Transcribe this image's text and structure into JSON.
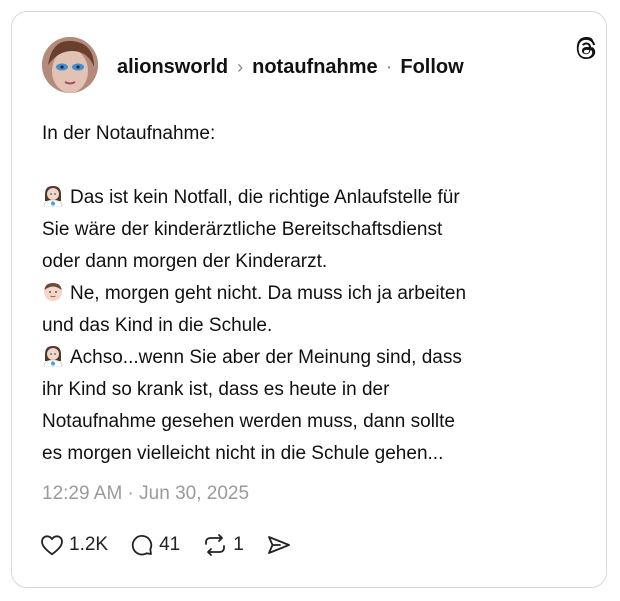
{
  "post": {
    "author": "alionsworld",
    "community": "notaufnahme",
    "follow_label": "Follow",
    "lines": [
      {
        "text": "In der Notaufnahme:",
        "emoji": ""
      },
      {
        "text": "",
        "emoji": ""
      },
      {
        "text": "Das ist kein Notfall, die richtige Anlaufstelle für",
        "emoji": "woman-health-worker"
      },
      {
        "text": "Sie wäre der kinderärztliche Bereitschaftsdienst",
        "emoji": ""
      },
      {
        "text": "oder dann morgen der Kinderarzt.",
        "emoji": ""
      },
      {
        "text": "Ne, morgen geht nicht. Da muss ich ja arbeiten",
        "emoji": "man-face"
      },
      {
        "text": "und das Kind in die Schule.",
        "emoji": ""
      },
      {
        "text": "Achso...wenn Sie aber der Meinung sind, dass",
        "emoji": "woman-health-worker"
      },
      {
        "text": "ihr Kind so krank ist, dass es heute in der",
        "emoji": ""
      },
      {
        "text": "Notaufnahme gesehen werden muss, dann sollte",
        "emoji": ""
      },
      {
        "text": "es morgen vielleicht nicht in die Schule gehen...",
        "emoji": ""
      }
    ],
    "timestamp": "12:29 AM · Jun 30, 2025",
    "likes": "1.2K",
    "replies": "41",
    "reposts": "1"
  },
  "icons": {
    "app": "threads-logo-icon",
    "like": "heart-icon",
    "reply": "speech-bubble-icon",
    "repost": "repost-icon",
    "share": "send-icon"
  }
}
